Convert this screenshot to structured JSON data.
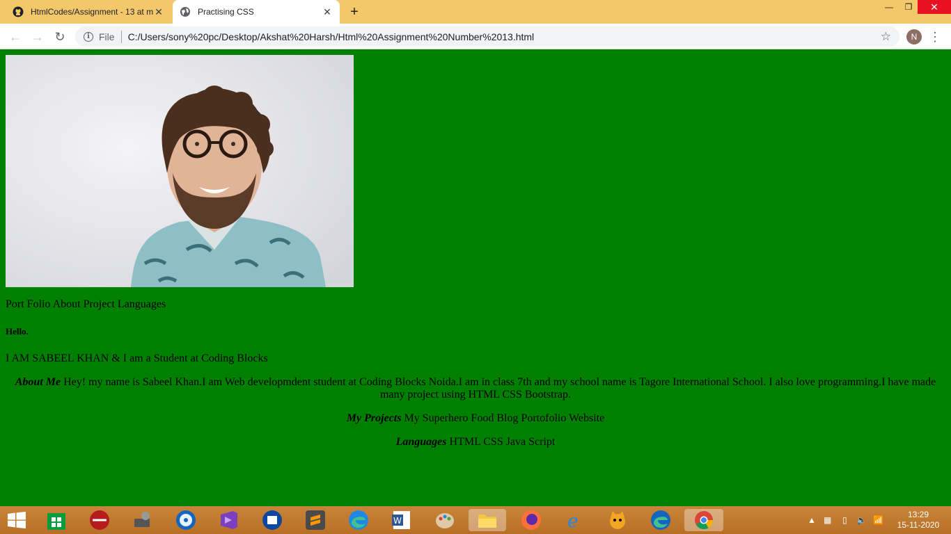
{
  "browser": {
    "tabs": [
      {
        "title": "HtmlCodes/Assignment - 13 at m",
        "active": false
      },
      {
        "title": "Practising CSS",
        "active": true
      }
    ],
    "new_tab": "+",
    "url_scheme": "File",
    "url": "C:/Users/sony%20pc/Desktop/Akshat%20Harsh/Html%20Assignment%20Number%2013.html",
    "profile_initial": "N"
  },
  "page": {
    "nav": "Port Folio About Project Languages",
    "greeting": "Hello.",
    "intro": "I AM SABEEL KHAN & I am a Student at Coding Blocks",
    "about": {
      "heading": "About Me",
      "text": " Hey! my name is Sabeel Khan.I am Web developmdent student at Coding Blocks Noida.I am in class 7th and my school name is Tagore International School. I also love programming.I have made many project using HTML CSS Bootstrap."
    },
    "projects": {
      "heading": "My Projects",
      "text": " My Superhero Food Blog Portofolio Website"
    },
    "languages": {
      "heading": "Languages",
      "text": " HTML CSS Java Script"
    }
  },
  "taskbar": {
    "time": "13:29",
    "date": "15-11-2020",
    "icons": [
      "store-icon",
      "media-icon",
      "tools-icon",
      "disc-icon",
      "visual-studio-icon",
      "video-icon",
      "sublime-icon",
      "edge-icon",
      "word-icon",
      "paint-icon",
      "file-explorer-icon",
      "firefox-icon",
      "internet-explorer-icon",
      "scratch-icon",
      "edge-icon",
      "chrome-icon"
    ]
  }
}
